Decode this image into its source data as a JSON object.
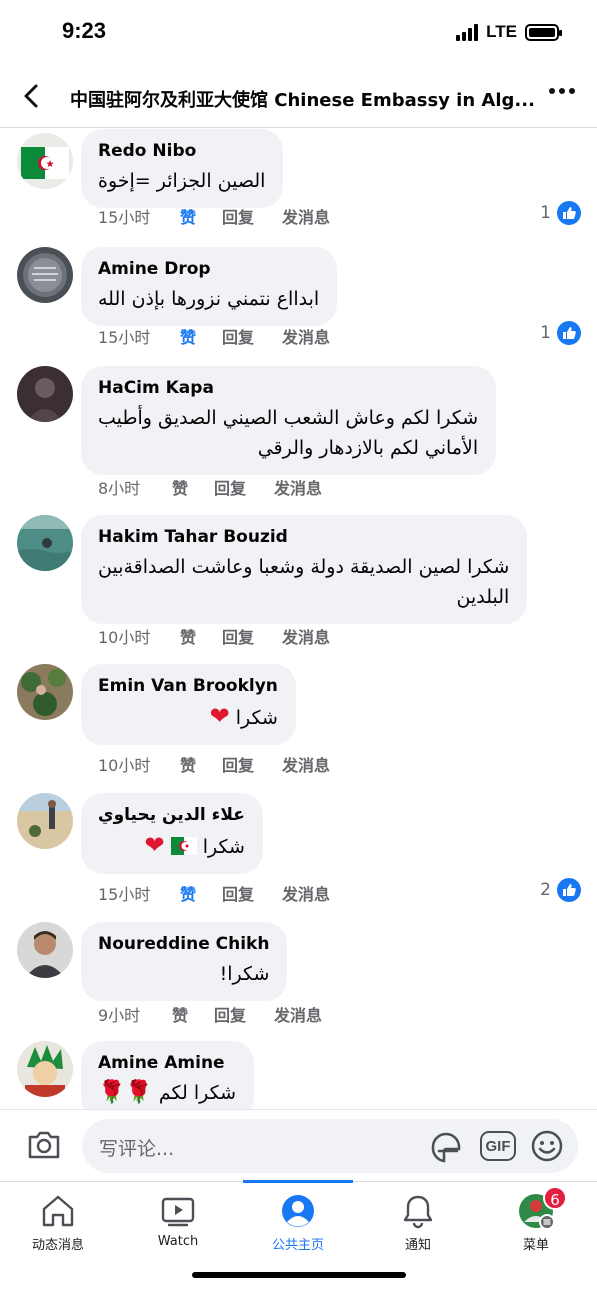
{
  "status_bar": {
    "time": "9:23",
    "network": "LTE",
    "battery_level": 1.0
  },
  "header": {
    "title": "中国驻阿尔及利亚大使馆 Chinese Embassy in Alg..."
  },
  "actions_labels": {
    "like": "赞",
    "reply": "回复",
    "message": "发消息"
  },
  "comments": [
    {
      "author": "Redo Nibo",
      "text": "الصين الجزائر =إخوة",
      "time": "15小时",
      "liked": true,
      "likes": "1"
    },
    {
      "author": "Amine Drop",
      "text": "ابدااع نتمني نزورها بإذن الله",
      "time": "15小时",
      "liked": true,
      "likes": "1"
    },
    {
      "author": "HaCim Kapa",
      "text_lines": [
        "شكرا لكم وعاش الشعب الصيني الصديق وأطيب",
        "الأماني لكم بالازدهار والرقي"
      ],
      "time": "8小时",
      "liked": false,
      "likes": ""
    },
    {
      "author": "Hakim Tahar Bouzid",
      "text_lines": [
        "شكرا لصين الصديقة دولة وشعبا وعاشت الصداقةبين",
        "البلدين"
      ],
      "time": "10小时",
      "liked": false,
      "likes": ""
    },
    {
      "author": "Emin Van Brooklyn",
      "text": "شكرا",
      "time": "10小时",
      "liked": false,
      "likes": ""
    },
    {
      "author": "علاء الدين يحياوي",
      "text": "شكرا",
      "time": "15小时",
      "liked": true,
      "likes": "2"
    },
    {
      "author": "Noureddine Chikh",
      "text": "شكرا!",
      "time": "9小时",
      "liked": false,
      "likes": ""
    },
    {
      "author": "Amine Amine",
      "text": "شكرا لكم",
      "time": "",
      "liked": false,
      "likes": ""
    }
  ],
  "composer": {
    "placeholder": "写评论..."
  },
  "tabbar": {
    "tabs": [
      {
        "label": "动态消息",
        "icon": "home-icon"
      },
      {
        "label": "Watch",
        "icon": "watch-icon"
      },
      {
        "label": "公共主页",
        "icon": "pages-icon",
        "active": true
      },
      {
        "label": "通知",
        "icon": "bell-icon"
      },
      {
        "label": "菜单",
        "icon": "profile-menu-icon"
      }
    ],
    "menu_badge": "6"
  },
  "colors": {
    "accent": "#1877f2",
    "bubble": "#f0f2f5",
    "badge": "#e41e3f",
    "heart": "#e0182d"
  }
}
